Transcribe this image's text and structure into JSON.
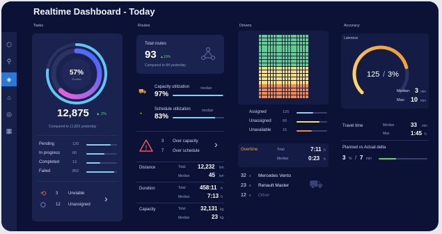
{
  "header": {
    "title": "Realtime Dashboard - Today"
  },
  "sections": {
    "tasks": "Tasks",
    "routes": "Routes",
    "drivers": "Drivers",
    "accuracy": "Accuracy"
  },
  "tasks": {
    "ring_percent": "57%",
    "ring_label": "Routed",
    "total": "12,875",
    "delta": "▲ 2%",
    "compared": "Compared to 11,823 yesterday",
    "progress": 0.57,
    "rows": [
      {
        "label": "Pending",
        "value": "120",
        "fill": 0.8
      },
      {
        "label": "In progress",
        "value": "60",
        "fill": 0.6
      },
      {
        "label": "Completed",
        "value": "13",
        "fill": 0.45
      },
      {
        "label": "Failed",
        "value": "852",
        "fill": 0.9
      }
    ],
    "unviable_count": "3",
    "unviable_label": "Unviable",
    "unassigned_count": "12",
    "unassigned_label": "Unassigned"
  },
  "routes": {
    "total_label": "Total routes",
    "total": "93",
    "delta": "▲10%",
    "compared": "Compared to 84 yesterday",
    "capacity_label": "Capacity utilization",
    "capacity_sub": "median",
    "capacity_value": "97%",
    "capacity_fill": 0.97,
    "schedule_label": "Schedule utilization",
    "schedule_sub": "median",
    "schedule_value": "83%",
    "schedule_fill": 0.83,
    "over_capacity_count": "3",
    "over_capacity_label": "Over capacity",
    "over_schedule_count": "7",
    "over_schedule_label": "Over schedule",
    "distance_label": "Distance",
    "distance_total_label": "Total",
    "distance_total": "12,232",
    "distance_total_unit": "km",
    "distance_median_label": "Median",
    "distance_median": "45",
    "distance_median_unit": "km",
    "duration_label": "Duration",
    "duration_total_label": "Total",
    "duration_total": "458:11",
    "duration_total_unit": "h",
    "duration_median_label": "Median",
    "duration_median": "7:13",
    "duration_median_unit": "h",
    "capacity2_label": "Capacity",
    "capacity2_total_label": "Total",
    "capacity2_total": "32,131",
    "capacity2_total_unit": "kg",
    "capacity2_median_label": "Median",
    "capacity2_median": "23",
    "capacity2_median_unit": "kg"
  },
  "drivers": {
    "grid": {
      "cols": 17,
      "rows": 18,
      "green_rows": 9,
      "yellow_rows": 5,
      "orange_rows": 4,
      "green": "#5ad18c",
      "yellow": "#f3e070",
      "orange": "#ef8a4c"
    },
    "legend": [
      {
        "label": "Assigned",
        "value": "120",
        "color": "#86d0f5",
        "fill": 0.55
      },
      {
        "label": "Unassigned",
        "value": "60",
        "color": "#f3e070",
        "fill": 0.75
      },
      {
        "label": "Unavailable",
        "value": "15",
        "color": "#ef8a4c",
        "fill": 0.5
      }
    ],
    "overtime_label": "Overtime",
    "overtime_total_label": "Total",
    "overtime_total": "7:11",
    "overtime_total_unit": "h",
    "overtime_median_label": "Median",
    "overtime_median": "0:23",
    "overtime_median_unit": "h",
    "vehicles": [
      {
        "count": "32",
        "unit": "x",
        "name": "Mercedes Vento"
      },
      {
        "count": "23",
        "unit": "x",
        "name": "Renault Master"
      },
      {
        "count": "12",
        "unit": "x",
        "name": "Other"
      }
    ]
  },
  "accuracy": {
    "lateness_label": "Lateness",
    "gauge_value": "125",
    "gauge_percent": "3%",
    "gauge_fill": 0.78,
    "median_label": "Median:",
    "median_value": "3",
    "median_unit": "min",
    "max_label": "Max:",
    "max_value": "10",
    "max_unit": "min",
    "travel_label": "Travel time",
    "travel_median_label": "Median",
    "travel_median": "33",
    "travel_median_unit": "min",
    "travel_max_label": "Max",
    "travel_max": "1:45",
    "travel_max_unit": "h",
    "planned_label": "Planned vs Actual delta",
    "planned_left": "3",
    "planned_left_unit": "%",
    "planned_sep": "/",
    "planned_right": "7",
    "planned_right_unit": "min",
    "planned_fill": 0.35
  },
  "colors": {
    "accent": "#2b78d8",
    "green": "#4cd96d",
    "cyan": "#86d0f5",
    "orange": "#f0a23a",
    "warning": "#ef5b5b"
  }
}
